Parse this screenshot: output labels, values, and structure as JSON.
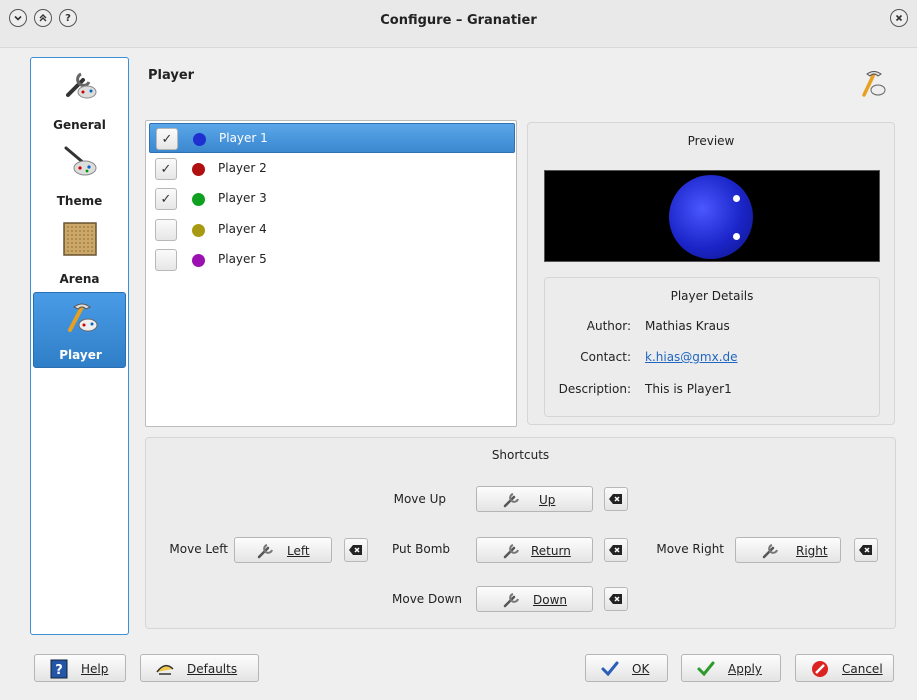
{
  "window": {
    "title": "Configure – Granatier",
    "close_icon": "close-icon",
    "shade_icon": "chevron-down-icon",
    "keep_above_icon": "chevrons-up-icon",
    "help_icon": "question-icon"
  },
  "sidebar": {
    "items": [
      {
        "label": "General",
        "icon": "general-settings-icon",
        "active": false
      },
      {
        "label": "Theme",
        "icon": "theme-icon",
        "active": false
      },
      {
        "label": "Arena",
        "icon": "arena-icon",
        "active": false
      },
      {
        "label": "Player",
        "icon": "player-icon",
        "active": true
      }
    ]
  },
  "page": {
    "title": "Player",
    "icon": "player-icon"
  },
  "players": [
    {
      "label": "Player 1",
      "checked": true,
      "color": "#1f2fd0",
      "selected": true
    },
    {
      "label": "Player 2",
      "checked": true,
      "color": "#b01010",
      "selected": false
    },
    {
      "label": "Player 3",
      "checked": true,
      "color": "#10a020",
      "selected": false
    },
    {
      "label": "Player 4",
      "checked": false,
      "color": "#a89a10",
      "selected": false
    },
    {
      "label": "Player 5",
      "checked": false,
      "color": "#9a10b0",
      "selected": false
    }
  ],
  "preview": {
    "title": "Preview"
  },
  "details": {
    "title": "Player Details",
    "author_label": "Author:",
    "author_value": "Mathias Kraus",
    "contact_label": "Contact:",
    "contact_value": "k.hias@gmx.de",
    "description_label": "Description:",
    "description_value": "This is Player1"
  },
  "shortcuts": {
    "title": "Shortcuts",
    "move_up": {
      "label": "Move Up",
      "key": "Up"
    },
    "move_left": {
      "label": "Move Left",
      "key": "Left"
    },
    "put_bomb": {
      "label": "Put Bomb",
      "key": "Return"
    },
    "move_right": {
      "label": "Move Right",
      "key": "Right"
    },
    "move_down": {
      "label": "Move Down",
      "key": "Down"
    }
  },
  "buttons": {
    "help": "Help",
    "defaults": "Defaults",
    "ok": "OK",
    "apply": "Apply",
    "cancel": "Cancel"
  },
  "colors": {
    "accent": "#3d8fd6",
    "selection": "#4a9ce6",
    "link": "#2167c2"
  }
}
